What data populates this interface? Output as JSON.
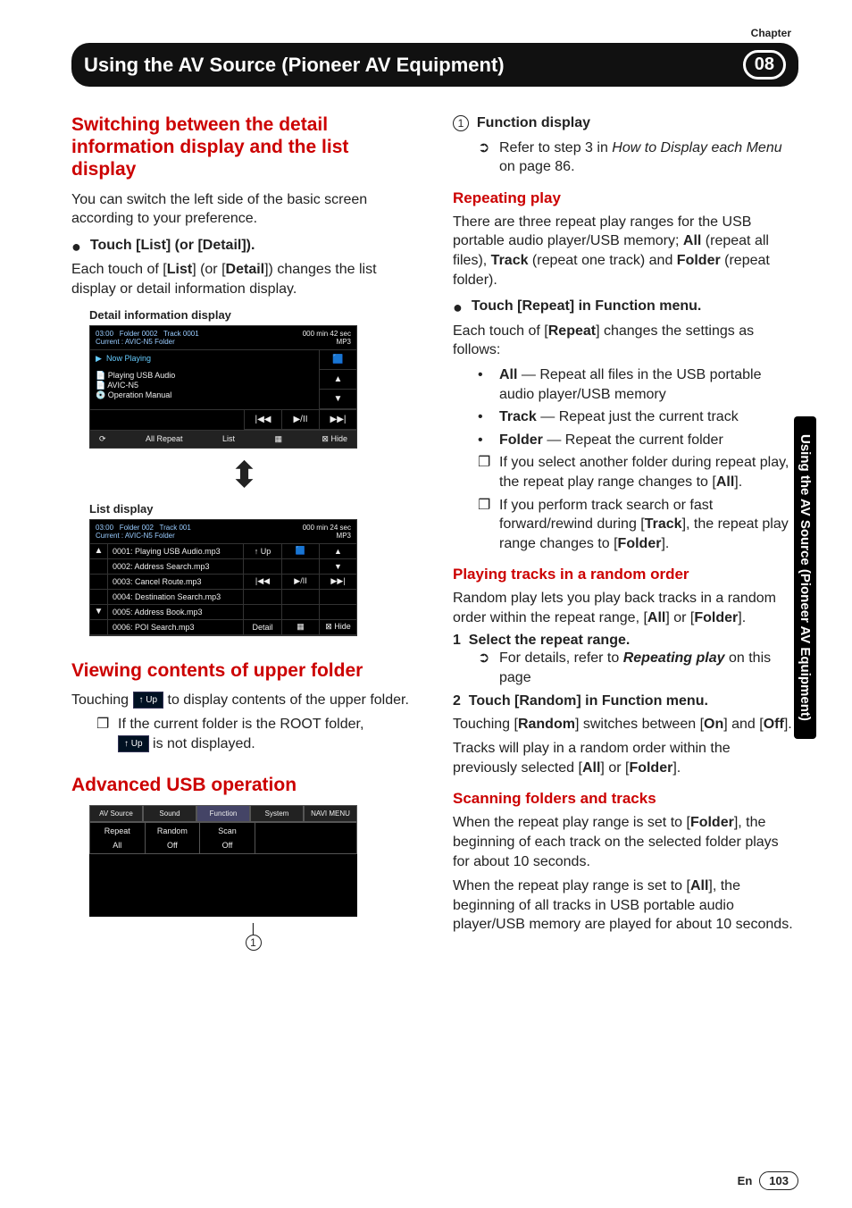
{
  "chapter_label": "Chapter",
  "chapter_num": "08",
  "header_title": "Using the AV Source (Pioneer AV Equipment)",
  "sidebar_text": "Using the AV Source (Pioneer AV Equipment)",
  "left": {
    "h1": "Switching between the detail information display and the list display",
    "p1": "You can switch the left side of the basic screen according to your preference.",
    "step1_title": "Touch [List] (or [Detail]).",
    "step1_body_a": "Each touch of [",
    "step1_body_b": "] (or [",
    "step1_body_c": "]) changes the list display or detail information display.",
    "list_word": "List",
    "detail_word": "Detail",
    "caption1": "Detail information display",
    "detail_shot": {
      "time_min": "000 min",
      "time_sec": "42 sec",
      "fmt": "MP3",
      "clock": "03:00",
      "folder_label": "Folder",
      "folder_val": "0002",
      "track_label": "Track",
      "track_val": "0001",
      "current": "Current : AVIC-N5 Folder",
      "now_playing": "Now Playing",
      "line1": "Playing USB Audio",
      "line2": "AVIC-N5",
      "line3": "Operation Manual",
      "prev": "|◀◀",
      "play": "▶/II",
      "next": "▶▶|",
      "footer_repeat": "All Repeat",
      "footer_list": "List",
      "footer_hide": "⊠ Hide"
    },
    "caption2": "List display",
    "list_shot": {
      "time_min": "000 min",
      "time_sec": "24 sec",
      "fmt": "MP3",
      "clock": "03:00",
      "folder_label": "Folder",
      "folder_val": "002",
      "track_label": "Track",
      "track_val": "001",
      "current": "Current : AVIC-N5 Folder",
      "items": [
        "0001: Playing USB Audio.mp3",
        "0002: Address Search.mp3",
        "0003: Cancel Route.mp3",
        "0004: Destination Search.mp3",
        "0005: Address Book.mp3",
        "0006: POI Search.mp3"
      ],
      "up_btn": "↑ Up",
      "prev": "|◀◀",
      "play": "▶/II",
      "next": "▶▶|",
      "detail_btn": "Detail",
      "footer_hide": "⊠ Hide"
    },
    "h2": "Viewing contents of upper folder",
    "p2a": "Touching ",
    "up_badge": "↑ Up",
    "p2b": " to display contents of the upper folder.",
    "note1a": "If the current folder is the ROOT folder, ",
    "note1b": " is not displayed.",
    "h3": "Advanced USB operation",
    "func_shot": {
      "tabs": [
        "AV Source",
        "Sound",
        "Function",
        "System",
        "NAVI MENU"
      ],
      "items": [
        {
          "lbl": "Repeat",
          "val": "All"
        },
        {
          "lbl": "Random",
          "val": "Off"
        },
        {
          "lbl": "Scan",
          "val": "Off"
        }
      ]
    },
    "callout_num": "1"
  },
  "right": {
    "line1_label": "Function display",
    "line1_body_a": "Refer to step 3 in ",
    "line1_body_ital": "How to Display each Menu",
    "line1_body_b": " on page 86.",
    "h_repeat": "Repeating play",
    "p_repeat_a": "There are three repeat play ranges for the USB portable audio player/USB memory; ",
    "p_repeat_b": " (repeat all files), ",
    "p_repeat_c": " (repeat one track) and ",
    "p_repeat_d": " (repeat folder).",
    "all": "All",
    "track": "Track",
    "folder": "Folder",
    "repeat_step": "Touch [Repeat] in Function menu.",
    "repeat_desc_a": "Each touch of [",
    "repeat_desc_b": "] changes the settings as follows:",
    "repeat_word": "Repeat",
    "repeat_items": [
      {
        "bold": "All",
        "rest": " — Repeat all files in the USB portable audio player/USB memory"
      },
      {
        "bold": "Track",
        "rest": " — Repeat just the current track"
      },
      {
        "bold": "Folder",
        "rest": " — Repeat the current folder"
      }
    ],
    "note_r1_a": "If you select another folder during repeat play, the repeat play range changes to [",
    "note_r1_b": "].",
    "note_r2_a": "If you perform track search or fast forward/rewind during [",
    "note_r2_b": "], the repeat play range changes to [",
    "note_r2_c": "].",
    "h_random": "Playing tracks in a random order",
    "p_random_a": "Random play lets you play back tracks in a random order within the repeat range, [",
    "p_random_b": "] or [",
    "p_random_c": "].",
    "rand_s1": "Select the repeat range.",
    "rand_s1_sub_a": "For details, refer to ",
    "rand_s1_sub_ital": "Repeating play",
    "rand_s1_sub_b": " on this page",
    "rand_s2": "Touch [Random] in Function menu.",
    "rand_p1_a": "Touching [",
    "rand_p1_b": "] switches between [",
    "rand_p1_c": "] and [",
    "rand_p1_d": "].",
    "random_word": "Random",
    "on": "On",
    "off": "Off",
    "rand_p2_a": "Tracks will play in a random order within the previously selected [",
    "rand_p2_b": "] or [",
    "rand_p2_c": "].",
    "h_scan": "Scanning folders and tracks",
    "scan_p1_a": "When the repeat play range is set to [",
    "scan_p1_b": "], the beginning of each track on the selected folder plays for about 10 seconds.",
    "scan_p2_a": "When the repeat play range is set to [",
    "scan_p2_b": "], the beginning of all tracks in USB portable audio player/USB memory are played for about 10 seconds."
  },
  "footer_lang": "En",
  "footer_page": "103"
}
